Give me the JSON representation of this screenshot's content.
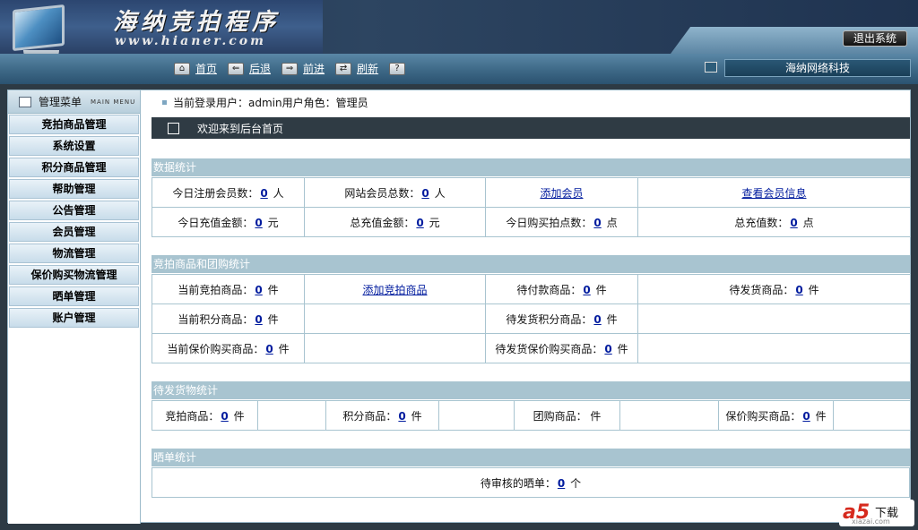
{
  "header": {
    "title": "海纳竞拍程序",
    "url": "www.hianer.com",
    "logout_label": "退出系统"
  },
  "nav": {
    "items": [
      {
        "icon": "home-icon",
        "icon_glyph": "⌂",
        "label": "首页"
      },
      {
        "icon": "back-arrow-icon",
        "icon_glyph": "⇐",
        "label": "后退"
      },
      {
        "icon": "forward-arrow-icon",
        "icon_glyph": "⇒",
        "label": "前进"
      },
      {
        "icon": "refresh-icon",
        "icon_glyph": "⇄",
        "label": "刷新"
      },
      {
        "icon": "help-icon",
        "icon_glyph": "?",
        "label": ""
      }
    ],
    "company": "海纳网络科技"
  },
  "sidebar": {
    "title": "管理菜单",
    "subtitle": "MAIN MENU",
    "items": [
      {
        "label": "竞拍商品管理"
      },
      {
        "label": "系统设置"
      },
      {
        "label": "积分商品管理"
      },
      {
        "label": "帮助管理"
      },
      {
        "label": "公告管理"
      },
      {
        "label": "会员管理"
      },
      {
        "label": "物流管理"
      },
      {
        "label": "保价购买物流管理"
      },
      {
        "label": "晒单管理"
      },
      {
        "label": "账户管理"
      }
    ]
  },
  "userbar": {
    "text": "当前登录用户：admin用户角色：管理员"
  },
  "welcome": {
    "text": "欢迎来到后台首页"
  },
  "data_stats": {
    "title": "数据统计",
    "today_reg_label": "今日注册会员数：",
    "today_reg_value": "0",
    "today_reg_unit": "人",
    "total_members_label": "网站会员总数：",
    "total_members_value": "0",
    "total_members_unit": "人",
    "add_member_link": "添加会员",
    "view_members_link": "查看会员信息",
    "today_recharge_label": "今日充值金额：",
    "today_recharge_value": "0",
    "today_recharge_unit": "元",
    "total_recharge_label": "总充值金额：",
    "total_recharge_value": "0",
    "total_recharge_unit": "元",
    "today_points_label": "今日购买拍点数：",
    "today_points_value": "0",
    "today_points_unit": "点",
    "total_points_label": "总充值数：",
    "total_points_value": "0",
    "total_points_unit": "点"
  },
  "goods_stats": {
    "title": "竞拍商品和团购统计",
    "current_auction_label": "当前竞拍商品：",
    "current_auction_value": "0",
    "current_auction_unit": "件",
    "add_auction_link": "添加竞拍商品",
    "pending_pay_label": "待付款商品：",
    "pending_pay_value": "0",
    "pending_pay_unit": "件",
    "pending_ship_label": "待发货商品：",
    "pending_ship_value": "0",
    "pending_ship_unit": "件",
    "current_points_label": "当前积分商品：",
    "current_points_value": "0",
    "current_points_unit": "件",
    "pending_points_ship_label": "待发货积分商品：",
    "pending_points_ship_value": "0",
    "pending_points_ship_unit": "件",
    "current_insured_label": "当前保价购买商品：",
    "current_insured_value": "0",
    "current_insured_unit": "件",
    "pending_insured_ship_label": "待发货保价购买商品：",
    "pending_insured_ship_value": "0",
    "pending_insured_ship_unit": "件"
  },
  "shipping_stats": {
    "title": "待发货物统计",
    "auction_label": "竞拍商品：",
    "auction_value": "0",
    "auction_unit": "件",
    "points_label": "积分商品：",
    "points_value": "0",
    "points_unit": "件",
    "group_label": "团购商品：",
    "group_unit": "件",
    "insured_label": "保价购买商品：",
    "insured_value": "0",
    "insured_unit": "件"
  },
  "showcase_stats": {
    "title": "晒单统计",
    "pending_label": "待审核的晒单：",
    "pending_value": "0",
    "pending_unit": "个"
  },
  "watermark": {
    "logo": "a5",
    "text": "下载",
    "sub": "xiazai.com"
  }
}
